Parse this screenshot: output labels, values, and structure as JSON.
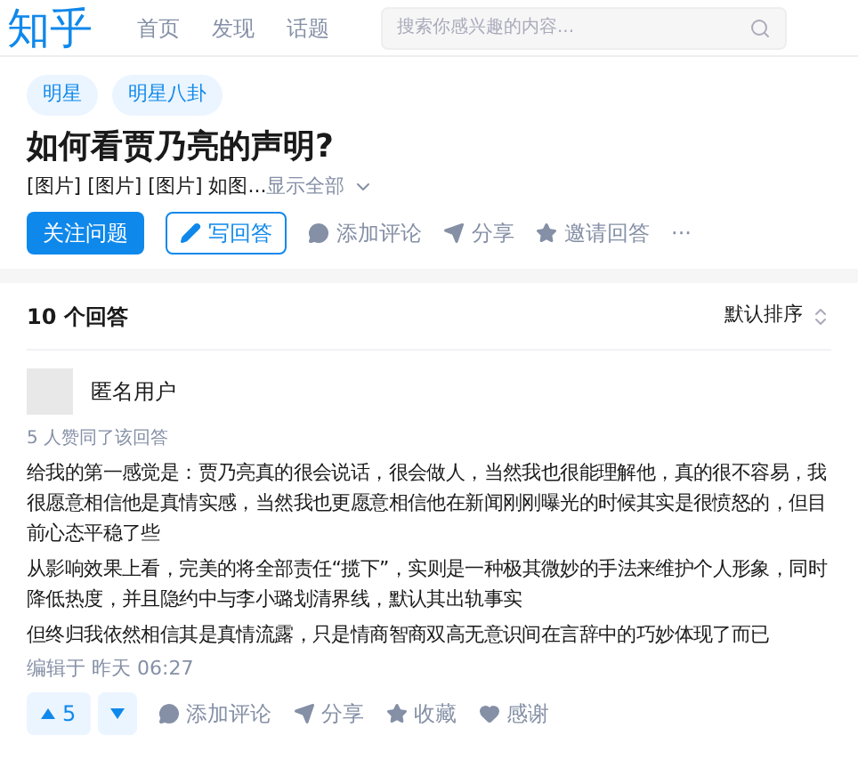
{
  "header": {
    "logo": "知乎",
    "nav": [
      "首页",
      "发现",
      "话题"
    ],
    "search": {
      "placeholder": "搜索你感兴趣的内容..."
    }
  },
  "question": {
    "topics": [
      "明星",
      "明星八卦"
    ],
    "title": "如何看贾乃亮的声明?",
    "excerpt": "[图片] [图片] [图片] 如图...",
    "show_all": "显示全部",
    "follow_button": "关注问题",
    "write_button": "写回答",
    "actions": [
      {
        "kind": "comment",
        "label": "添加评论"
      },
      {
        "kind": "share",
        "label": "分享"
      },
      {
        "kind": "invite",
        "label": "邀请回答"
      }
    ],
    "more": "···"
  },
  "answers": {
    "count": "10 个回答",
    "sort": "默认排序",
    "answer": {
      "author": "匿名用户",
      "votes": "5 人赞同了该回答",
      "paragraphs": [
        "给我的第一感觉是：贾乃亮真的很会说话，很会做人，当然我也很能理解他，真的很不容易，我很愿意相信他是真情实感，当然我也更愿意相信他在新闻刚刚曝光的时候其实是很愤怒的，但目前心态平稳了些",
        "从影响效果上看，完美的将全部责任“揽下”，实则是一种极其微妙的手法来维护个人形象，同时降低热度，并且隐约中与李小璐划清界线，默认其出轨事实",
        "但终归我依然相信其是真情流露，只是情商智商双高无意识间在言辞中的巧妙体现了而已"
      ],
      "edited": "编辑于 昨天 06:27",
      "upvote": "5",
      "actions": [
        {
          "kind": "comment",
          "label": "添加评论"
        },
        {
          "kind": "share",
          "label": "分享"
        },
        {
          "kind": "star",
          "label": "收藏"
        },
        {
          "kind": "heart",
          "label": "感谢"
        }
      ]
    }
  }
}
